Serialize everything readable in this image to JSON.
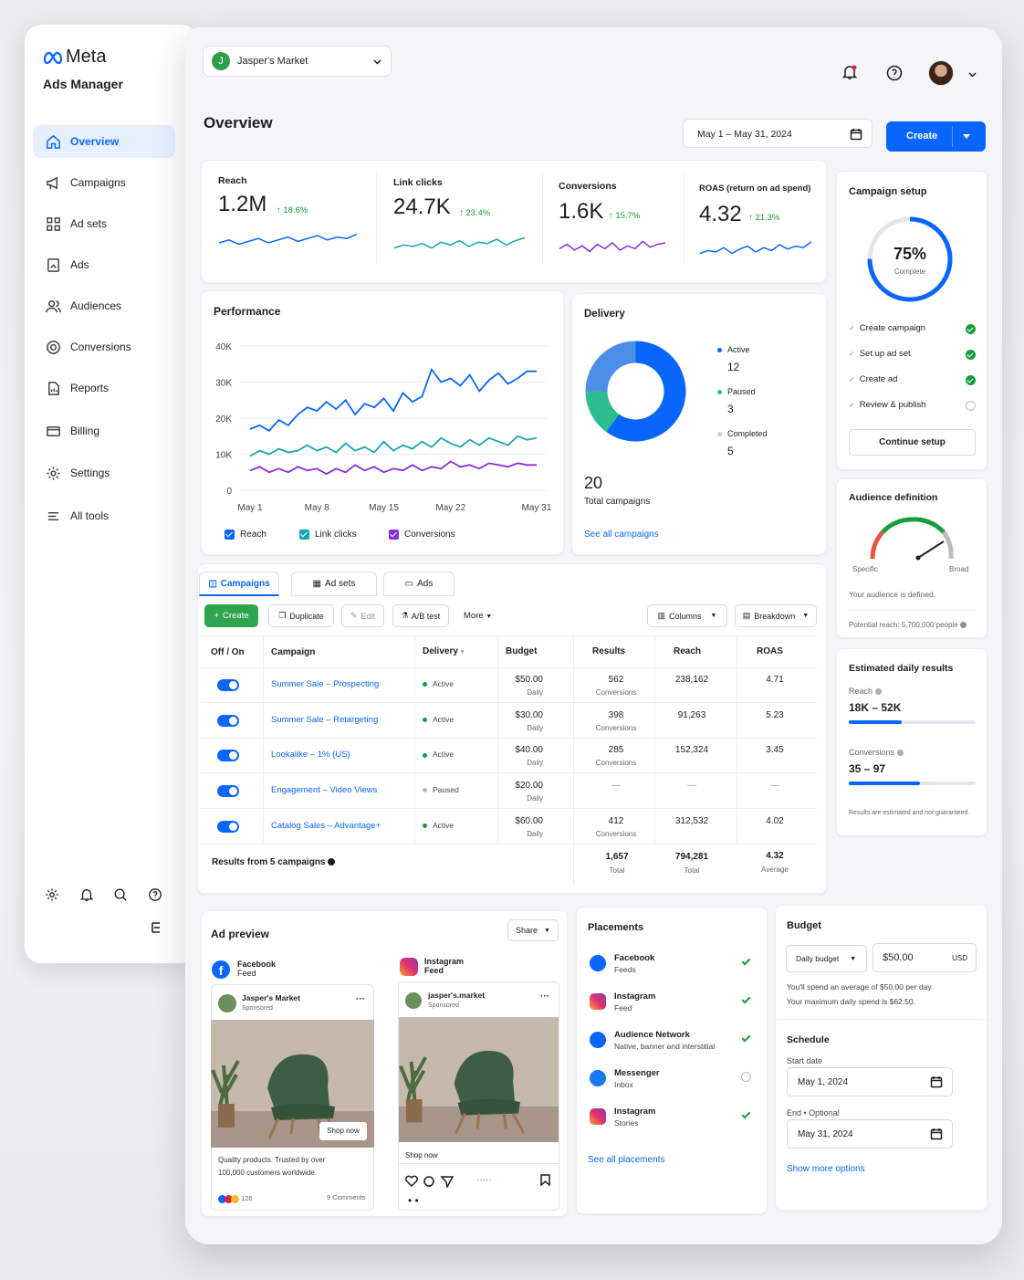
{
  "brand": {
    "logo": "Meta",
    "product": "Ads Manager"
  },
  "nav": [
    {
      "label": "Overview"
    },
    {
      "label": "Campaigns"
    },
    {
      "label": "Ad sets"
    },
    {
      "label": "Ads"
    },
    {
      "label": "Audiences"
    },
    {
      "label": "Conversions"
    },
    {
      "label": "Reports"
    },
    {
      "label": "Billing"
    },
    {
      "label": "Settings"
    },
    {
      "label": "All tools"
    }
  ],
  "account": {
    "initial": "J",
    "name": "Jasper's Market"
  },
  "page": {
    "title": "Overview",
    "date_range": "May 1 – May 31, 2024",
    "create_label": "Create"
  },
  "kpis": [
    {
      "label": "Reach",
      "value": "1.2M",
      "change": "18.6%",
      "color": "#0866ff",
      "spark": [
        5,
        7,
        4,
        6,
        8,
        5,
        7,
        9,
        6,
        8,
        10,
        7,
        9,
        8,
        11
      ]
    },
    {
      "label": "Link clicks",
      "value": "24.7K",
      "change": "23.4%",
      "color": "#14a6b8",
      "spark": [
        4,
        6,
        5,
        7,
        4,
        8,
        6,
        9,
        5,
        8,
        7,
        10,
        6,
        9,
        11
      ]
    },
    {
      "label": "Conversions",
      "value": "1.6K",
      "change": "15.7%",
      "color": "#8a2be2",
      "spark": [
        6,
        9,
        5,
        8,
        4,
        9,
        6,
        10,
        5,
        8,
        6,
        11,
        7,
        9,
        10
      ]
    },
    {
      "label": "ROAS (return on ad spend)",
      "value": "4.32",
      "change": "21.3%",
      "color": "#0866ff",
      "spark": [
        4,
        6,
        5,
        8,
        4,
        7,
        9,
        5,
        8,
        6,
        10,
        7,
        9,
        8,
        12
      ]
    }
  ],
  "performance": {
    "title": "Performance",
    "legend": [
      "Reach",
      "Link clicks",
      "Conversions"
    ]
  },
  "chart_data": {
    "type": "line",
    "title": "Performance",
    "x": [
      "May 1",
      "May 2",
      "May 3",
      "May 4",
      "May 5",
      "May 6",
      "May 7",
      "May 8",
      "May 9",
      "May 10",
      "May 11",
      "May 12",
      "May 13",
      "May 14",
      "May 15",
      "May 16",
      "May 17",
      "May 18",
      "May 19",
      "May 20",
      "May 21",
      "May 22",
      "May 23",
      "May 24",
      "May 25",
      "May 26",
      "May 27",
      "May 28",
      "May 29",
      "May 30",
      "May 31"
    ],
    "xticks": [
      "May 1",
      "May 8",
      "May 15",
      "May 22",
      "May 31"
    ],
    "yticks": [
      "40K",
      "30K",
      "20K",
      "10K",
      "0"
    ],
    "ylim": [
      0,
      40000
    ],
    "series": [
      {
        "name": "Reach",
        "color": "#0866ff",
        "values": [
          17000,
          18000,
          16500,
          19500,
          18000,
          21000,
          23000,
          22000,
          24500,
          22500,
          25000,
          21000,
          24000,
          23000,
          25500,
          22000,
          27000,
          24500,
          26000,
          33500,
          30000,
          31000,
          29000,
          32000,
          27500,
          30500,
          32500,
          29500,
          31000,
          33000,
          33000
        ]
      },
      {
        "name": "Link clicks",
        "color": "#14a6b8",
        "values": [
          9500,
          11000,
          10000,
          11500,
          10500,
          11000,
          12500,
          11000,
          12000,
          10500,
          13000,
          11000,
          12000,
          10500,
          13500,
          11000,
          12500,
          11500,
          13500,
          12000,
          14500,
          13000,
          12000,
          14000,
          12500,
          14500,
          13500,
          12500,
          15000,
          14000,
          14500
        ]
      },
      {
        "name": "Conversions",
        "color": "#8a2be2",
        "values": [
          5500,
          6500,
          5000,
          6000,
          5000,
          6500,
          5500,
          6000,
          4500,
          6000,
          5000,
          7000,
          5500,
          6500,
          5000,
          6000,
          5500,
          7000,
          5500,
          6500,
          6000,
          8000,
          6500,
          7000,
          6000,
          7500,
          7000,
          6500,
          7500,
          7000,
          7000
        ]
      }
    ]
  },
  "delivery": {
    "title": "Delivery",
    "items": [
      {
        "label": "Active",
        "value": "12",
        "color": "#0866ff"
      },
      {
        "label": "Paused",
        "value": "3",
        "color": "#2bbd8e"
      },
      {
        "label": "Completed",
        "value": "5",
        "color": "#4c8fe8"
      }
    ],
    "total": "20",
    "total_label": "Total campaigns",
    "link": "See all campaigns"
  },
  "setup": {
    "title": "Campaign setup",
    "percent": 75,
    "percent_label": "75%",
    "complete_label": "Complete",
    "steps": [
      {
        "label": "Create campaign",
        "done": true
      },
      {
        "label": "Set up ad set",
        "done": true
      },
      {
        "label": "Create ad",
        "done": true
      },
      {
        "label": "Review & publish",
        "done": false
      }
    ],
    "button": "Continue setup"
  },
  "audience": {
    "title": "Audience definition",
    "specific": "Specific",
    "broad": "Broad",
    "status": "Your audience is defined.",
    "potential": "Potential reach: 5,700,000 people"
  },
  "estimated": {
    "title": "Estimated daily results",
    "reach_label": "Reach",
    "reach_value": "18K – 52K",
    "reach_fill": 0.42,
    "conv_label": "Conversions",
    "conv_value": "35 – 97",
    "conv_fill": 0.56,
    "note": "Results are estimated and not guaranteed."
  },
  "tabs": [
    {
      "label": "Campaigns"
    },
    {
      "label": "Ad sets"
    },
    {
      "label": "Ads"
    }
  ],
  "toolbar": {
    "create": "Create",
    "duplicate": "Duplicate",
    "edit": "Edit",
    "abtest": "A/B test",
    "more": "More",
    "columns": "Columns",
    "breakdown": "Breakdown"
  },
  "table": {
    "headers": [
      "Off / On",
      "Campaign",
      "Delivery",
      "Budget",
      "Results",
      "Reach",
      "ROAS"
    ],
    "rows": [
      {
        "name": "Summer Sale – Prospecting",
        "status": "Active",
        "budget": "$50.00",
        "budget_sub": "Daily",
        "results": "562",
        "results_sub": "Conversions",
        "reach": "238,162",
        "roas": "4.71"
      },
      {
        "name": "Summer Sale – Retargeting",
        "status": "Active",
        "budget": "$30.00",
        "budget_sub": "Daily",
        "results": "398",
        "results_sub": "Conversions",
        "reach": "91,263",
        "roas": "5.23"
      },
      {
        "name": "Lookalike – 1% (US)",
        "status": "Active",
        "budget": "$40.00",
        "budget_sub": "Daily",
        "results": "285",
        "results_sub": "Conversions",
        "reach": "152,324",
        "roas": "3.45"
      },
      {
        "name": "Engagement – Video Views",
        "status": "Paused",
        "budget": "$20.00",
        "budget_sub": "Daily",
        "results": "—",
        "results_sub": "",
        "reach": "—",
        "roas": "—"
      },
      {
        "name": "Catalog Sales – Advantage+",
        "status": "Active",
        "budget": "$60.00",
        "budget_sub": "Daily",
        "results": "412",
        "results_sub": "Conversions",
        "reach": "312,532",
        "roas": "4.02"
      }
    ],
    "footer": {
      "label": "Results from 5 campaigns",
      "results": "1,657",
      "results_sub": "Total",
      "reach": "794,281",
      "reach_sub": "Total",
      "roas": "4.32",
      "roas_sub": "Average"
    }
  },
  "preview": {
    "title": "Ad preview",
    "share": "Share",
    "fb": {
      "platform": "Facebook",
      "placement": "Feed",
      "page": "Jasper's Market",
      "sponsored": "Sponsored",
      "cta": "Shop now",
      "caption1": "Quality products. Trusted by over",
      "caption2": "100,000 customers worldwide.",
      "reactions": "126",
      "comments": "9 Comments"
    },
    "ig": {
      "platform": "Instagram",
      "placement": "Feed",
      "handle": "jasper's.market",
      "sponsored": "Sponsored",
      "cta": "Shop now"
    }
  },
  "placements": {
    "title": "Placements",
    "items": [
      {
        "name": "Facebook",
        "sub": "Feeds",
        "on": true
      },
      {
        "name": "Instagram",
        "sub": "Feed",
        "on": true
      },
      {
        "name": "Audience Network",
        "sub": "Native, banner and interstitial",
        "on": true
      },
      {
        "name": "Messenger",
        "sub": "Inbox",
        "on": false
      },
      {
        "name": "Instagram",
        "sub": "Stories",
        "on": true
      }
    ],
    "link": "See all placements"
  },
  "budget": {
    "title": "Budget",
    "type": "Daily budget",
    "amount": "$50.00",
    "currency": "USD",
    "note1": "You'll spend an average of $50.00 per day.",
    "note2": "Your maximum daily spend is $62.50.",
    "schedule": "Schedule",
    "start_label": "Start date",
    "start": "May 1, 2024",
    "end_label": "End • Optional",
    "end": "May 31, 2024",
    "more": "Show more options"
  }
}
